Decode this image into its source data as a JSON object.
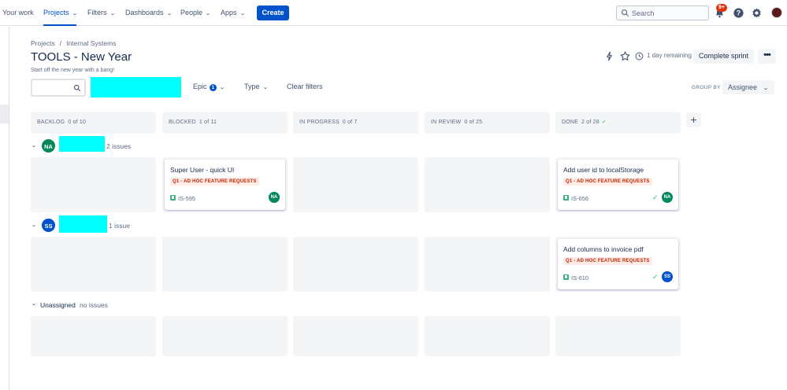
{
  "nav": {
    "items": [
      {
        "label": "Your work",
        "dropdown": false,
        "active": false
      },
      {
        "label": "Projects",
        "dropdown": true,
        "active": true
      },
      {
        "label": "Filters",
        "dropdown": true,
        "active": false
      },
      {
        "label": "Dashboards",
        "dropdown": true,
        "active": false
      },
      {
        "label": "People",
        "dropdown": true,
        "active": false
      },
      {
        "label": "Apps",
        "dropdown": true,
        "active": false
      }
    ],
    "create_label": "Create",
    "search_placeholder": "Search",
    "notification_badge": "9+",
    "icons": [
      "notification-icon",
      "help-icon",
      "settings-icon",
      "profile-avatar"
    ]
  },
  "breadcrumb": [
    "Projects",
    "Internal Systems"
  ],
  "breadcrumb_sep": "/",
  "page": {
    "title": "TOOLS - New Year",
    "subtitle": "Start off the new year with a bang!",
    "remaining": "1 day remaining",
    "complete_sprint": "Complete sprint",
    "more": "•••"
  },
  "filters": {
    "epic_label": "Epic",
    "epic_count": "1",
    "type_label": "Type",
    "clear_label": "Clear filters",
    "group_by_label": "GROUP BY",
    "group_by_value": "Assignee"
  },
  "columns": [
    {
      "name": "BACKLOG",
      "count": "0 of 10",
      "done": false
    },
    {
      "name": "BLOCKED",
      "count": "1 of 11",
      "done": false
    },
    {
      "name": "IN PROGRESS",
      "count": "0 of 7",
      "done": false
    },
    {
      "name": "IN REVIEW",
      "count": "0 of 25",
      "done": false
    },
    {
      "name": "DONE",
      "count": "2 of 28",
      "done": true
    }
  ],
  "swimlanes": [
    {
      "initials": "NA",
      "avatar_color": "#00875A",
      "count": "2 issues",
      "cards": [
        {
          "column": 1,
          "title": "Super User - quick UI",
          "epic": "Q1 - AD HOC FEATURE REQUESTS",
          "key": "IS-595",
          "done": false,
          "assignee": "NA"
        },
        {
          "column": 4,
          "title": "Add user id to localStorage",
          "epic": "Q1 - AD HOC FEATURE REQUESTS",
          "key": "IS-656",
          "done": true,
          "assignee": "NA"
        }
      ]
    },
    {
      "initials": "SS",
      "avatar_color": "#0052CC",
      "count": "1 issue",
      "cards": [
        {
          "column": 4,
          "title": "Add columns to invoice pdf",
          "epic": "Q1 - AD HOC FEATURE REQUESTS",
          "key": "IS-610",
          "done": true,
          "assignee": "SS"
        }
      ]
    }
  ],
  "unassigned": {
    "title": "Unassigned",
    "count": "no issues"
  },
  "colors": {
    "accent": "#0052CC",
    "done_check": "#36B37E",
    "epic_bg": "#FFEBE6",
    "epic_text": "#BF2600",
    "redacted": "#00FFFF"
  }
}
